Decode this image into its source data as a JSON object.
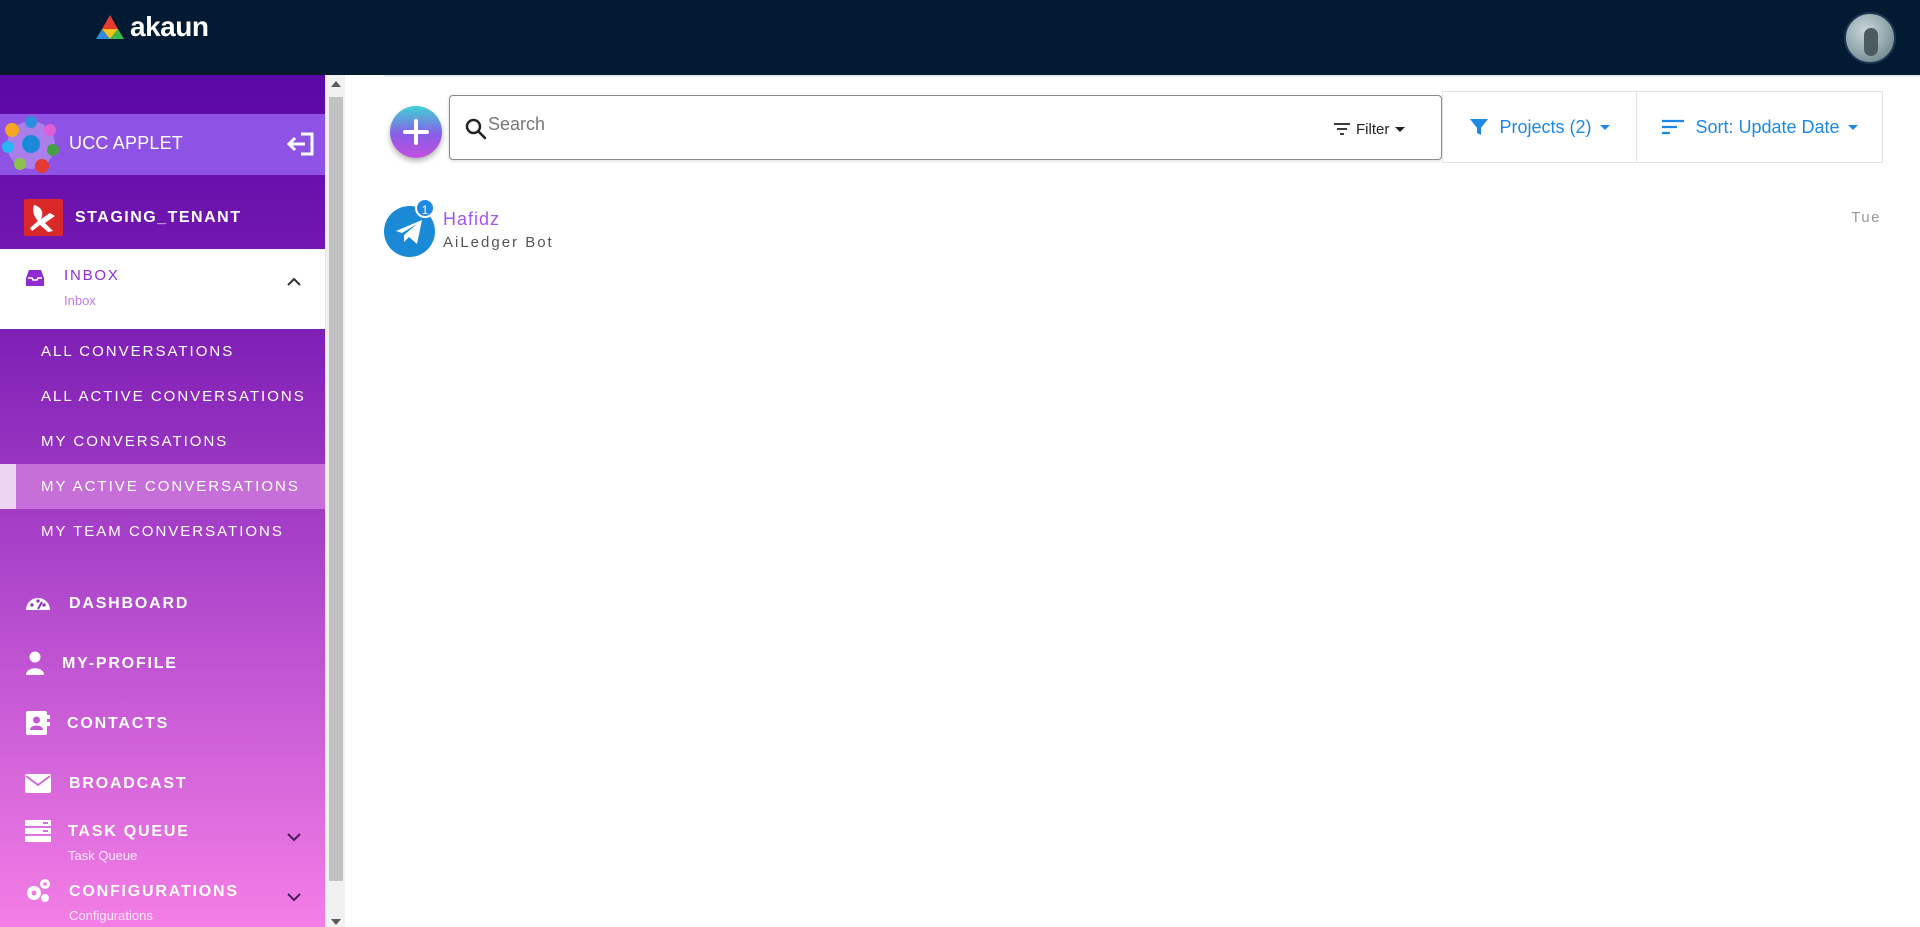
{
  "header": {
    "logo_text": "akaun"
  },
  "sidebar": {
    "applet_label": "UCC APPLET",
    "tenant_label": "STAGING_TENANT",
    "inbox": {
      "title": "INBOX",
      "subtitle": "Inbox"
    },
    "inbox_items": [
      "ALL CONVERSATIONS",
      "ALL ACTIVE CONVERSATIONS",
      "MY CONVERSATIONS",
      "MY ACTIVE CONVERSATIONS",
      "MY TEAM CONVERSATIONS"
    ],
    "active_item": "MY ACTIVE CONVERSATIONS",
    "nav": {
      "dashboard": "DASHBOARD",
      "my_profile": "MY-PROFILE",
      "contacts": "CONTACTS",
      "broadcast": "BROADCAST",
      "task_queue": "TASK QUEUE",
      "task_queue_sub": "Task Queue",
      "configurations": "CONFIGURATIONS",
      "configurations_sub": "Configurations"
    }
  },
  "toolbar": {
    "search_placeholder": "Search",
    "filter_label": "Filter",
    "projects_label": "Projects (2)",
    "sort_label": "Sort: Update Date"
  },
  "conversations": [
    {
      "name": "Hafidz",
      "subtitle": "AiLedger Bot",
      "time": "Tue",
      "badge": "1",
      "channel_icon": "telegram-icon"
    }
  ],
  "colors": {
    "topbar": "#031a33",
    "accent_blue": "#1e88e5",
    "accent_purple": "#8e2bd1",
    "sidebar_top": "#5a07a6",
    "sidebar_bottom": "#f47ee6"
  }
}
